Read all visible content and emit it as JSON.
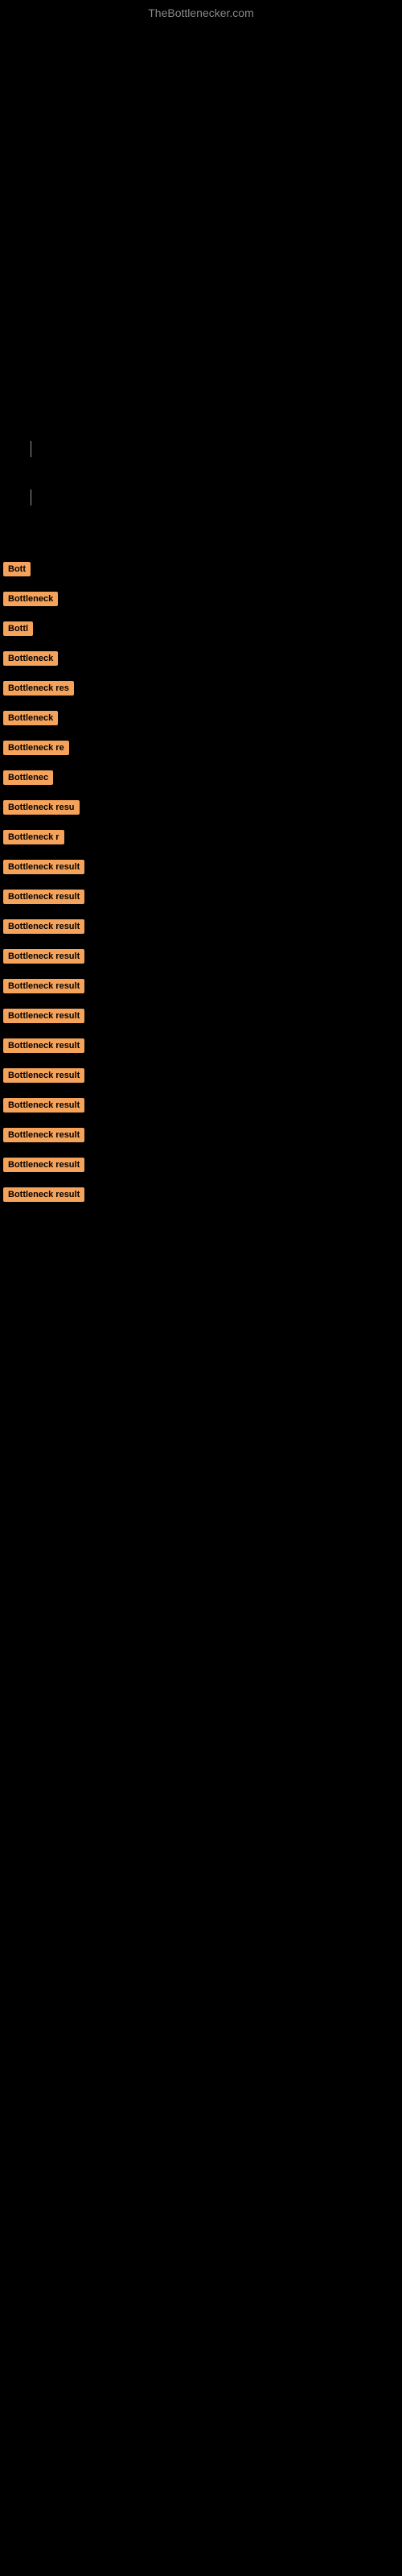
{
  "site": {
    "title": "TheBottlenecker.com"
  },
  "results": [
    {
      "id": 1,
      "label": "Bott",
      "width": 36
    },
    {
      "id": 2,
      "label": "Bottleneck",
      "width": 70
    },
    {
      "id": 3,
      "label": "Bottl",
      "width": 42
    },
    {
      "id": 4,
      "label": "Bottleneck",
      "width": 70
    },
    {
      "id": 5,
      "label": "Bottleneck res",
      "width": 100
    },
    {
      "id": 6,
      "label": "Bottleneck",
      "width": 70
    },
    {
      "id": 7,
      "label": "Bottleneck re",
      "width": 95
    },
    {
      "id": 8,
      "label": "Bottlenec",
      "width": 65
    },
    {
      "id": 9,
      "label": "Bottleneck resu",
      "width": 107
    },
    {
      "id": 10,
      "label": "Bottleneck r",
      "width": 82
    },
    {
      "id": 11,
      "label": "Bottleneck result",
      "width": 118
    },
    {
      "id": 12,
      "label": "Bottleneck result",
      "width": 118
    },
    {
      "id": 13,
      "label": "Bottleneck result",
      "width": 118
    },
    {
      "id": 14,
      "label": "Bottleneck result",
      "width": 118
    },
    {
      "id": 15,
      "label": "Bottleneck result",
      "width": 118
    },
    {
      "id": 16,
      "label": "Bottleneck result",
      "width": 118
    },
    {
      "id": 17,
      "label": "Bottleneck result",
      "width": 118
    },
    {
      "id": 18,
      "label": "Bottleneck result",
      "width": 118
    },
    {
      "id": 19,
      "label": "Bottleneck result",
      "width": 118
    },
    {
      "id": 20,
      "label": "Bottleneck result",
      "width": 118
    },
    {
      "id": 21,
      "label": "Bottleneck result",
      "width": 118
    },
    {
      "id": 22,
      "label": "Bottleneck result",
      "width": 118
    }
  ],
  "colors": {
    "background": "#000000",
    "tag_bg": "#f5a35a",
    "tag_text": "#000000",
    "title": "#888888"
  }
}
